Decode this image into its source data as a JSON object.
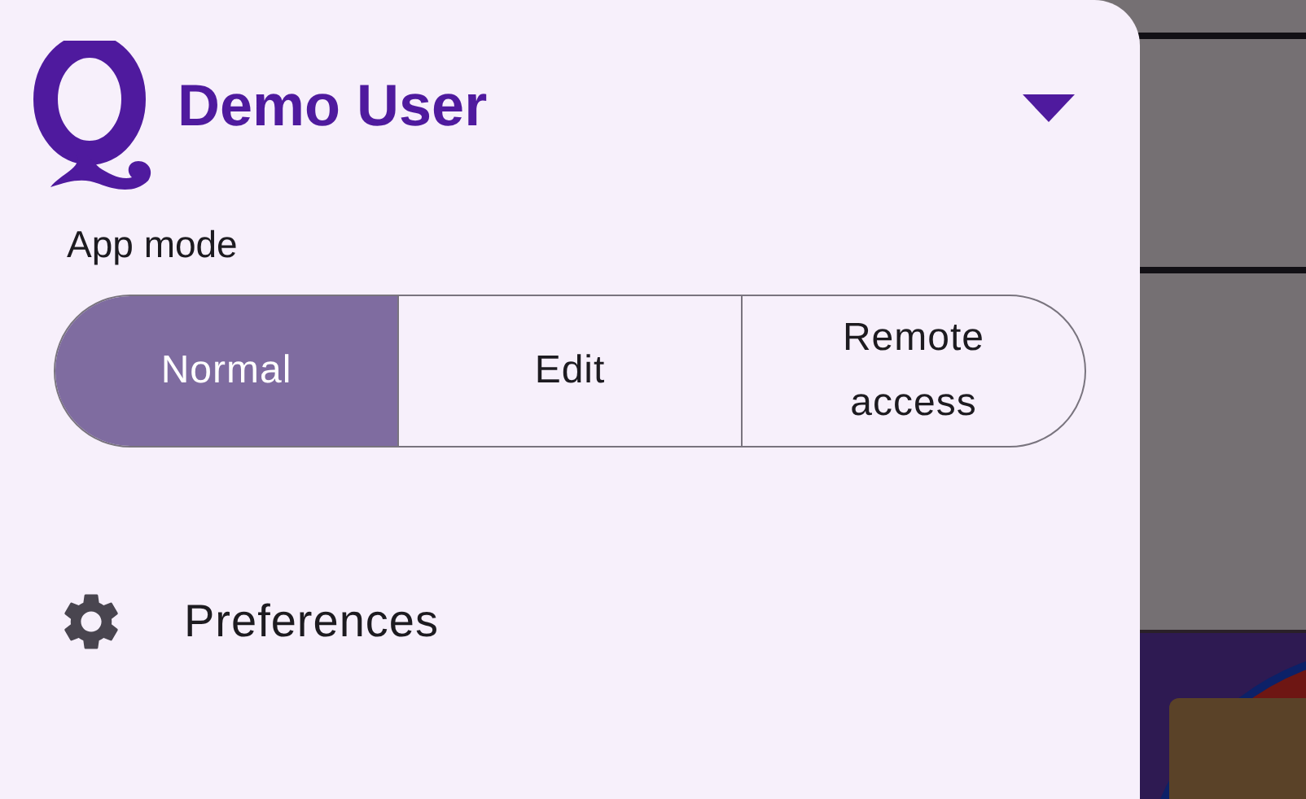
{
  "drawer": {
    "user_name": "Demo User",
    "app_mode": {
      "label": "App mode",
      "segments": [
        {
          "label": "Normal",
          "selected": true
        },
        {
          "label": "Edit",
          "selected": false
        },
        {
          "label": "Remote access",
          "selected": false
        }
      ]
    },
    "menu_items": [
      {
        "label": "Preferences"
      }
    ]
  }
}
